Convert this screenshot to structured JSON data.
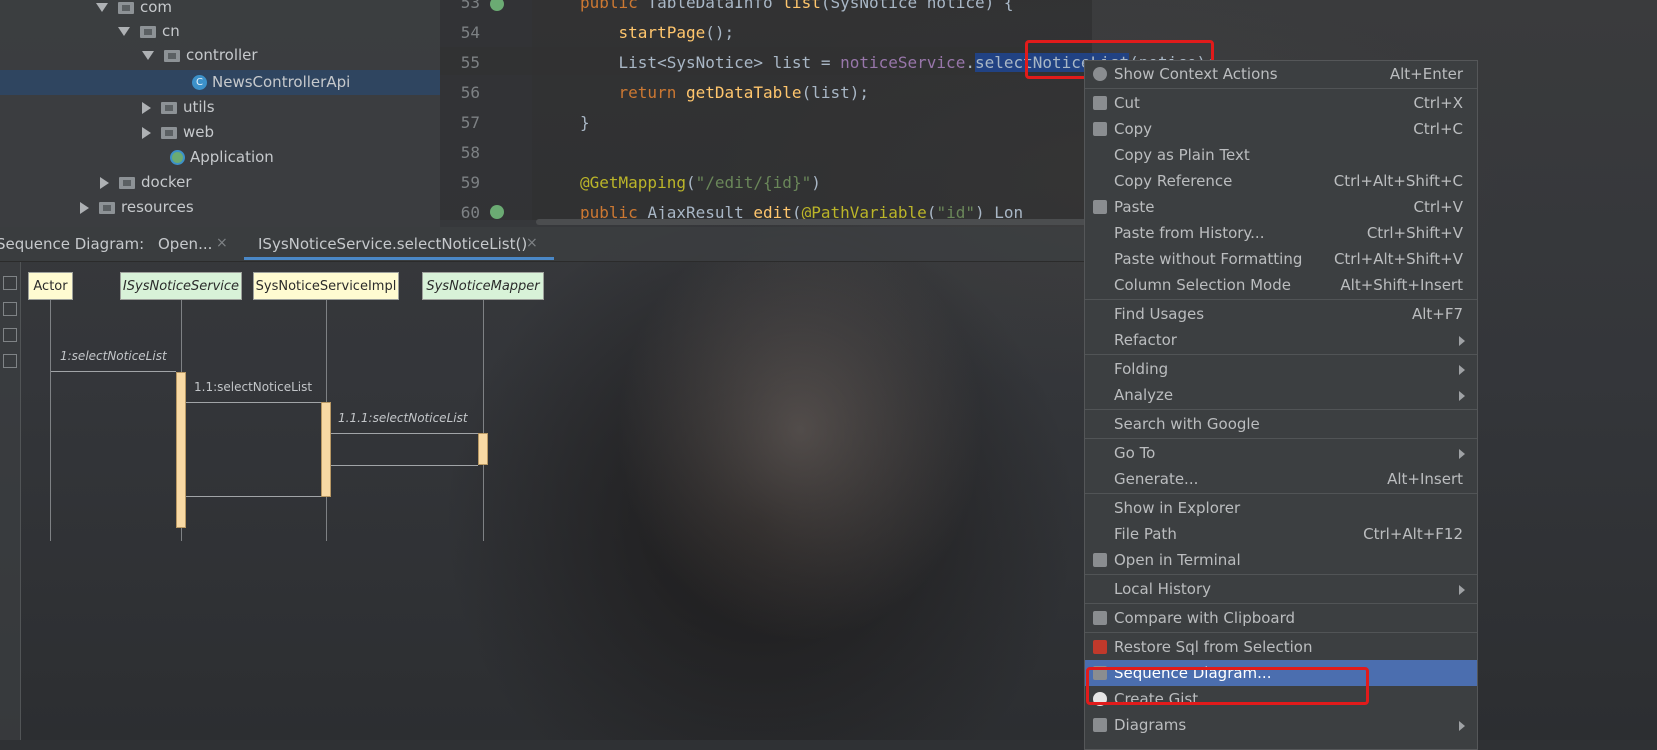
{
  "project_tree": {
    "items": [
      {
        "label": "com",
        "state": "expanded"
      },
      {
        "label": "cn",
        "state": "expanded"
      },
      {
        "label": "controller",
        "state": "expanded"
      },
      {
        "label": "NewsControllerApi",
        "state": "selected",
        "icon": "class-icon"
      },
      {
        "label": "utils",
        "state": "collapsed"
      },
      {
        "label": "web",
        "state": "collapsed"
      },
      {
        "label": "Application",
        "icon": "spring-app-icon"
      },
      {
        "label": "docker",
        "state": "collapsed"
      },
      {
        "label": "resources",
        "state": "collapsed"
      }
    ]
  },
  "editor": {
    "line_numbers": [
      "53",
      "54",
      "55",
      "56",
      "57",
      "58",
      "59",
      "60"
    ],
    "lines": [
      {
        "segments": [
          [
            "kw",
            "public "
          ],
          [
            "ty",
            "TableDataInfo "
          ],
          [
            "fn",
            "list"
          ],
          [
            "ty",
            "("
          ],
          [
            "ty",
            "SysNotice notice) {"
          ]
        ]
      },
      {
        "segments": [
          [
            "fn",
            "    startPage"
          ],
          [
            "ty",
            "();"
          ]
        ]
      },
      {
        "segments": [
          [
            "ty",
            "    "
          ],
          [
            "ty",
            "List"
          ],
          [
            "ty",
            "<SysNotice> list = "
          ],
          [
            "fd",
            "noticeService"
          ],
          [
            "ty",
            "."
          ],
          [
            "hl",
            "selectNoticeList"
          ],
          [
            "ty",
            "(notice);"
          ]
        ]
      },
      {
        "segments": [
          [
            "kw",
            "    return "
          ],
          [
            "fn",
            "getDataTable"
          ],
          [
            "ty",
            "(list);"
          ]
        ]
      },
      {
        "segments": [
          [
            "ty",
            "}"
          ]
        ]
      },
      {
        "segments": [
          [
            "ty",
            ""
          ]
        ]
      },
      {
        "segments": [
          [
            "an",
            "@GetMapping"
          ],
          [
            "ty",
            "("
          ],
          [
            "st",
            "\"/edit/{id}\""
          ],
          [
            "ty",
            ")"
          ]
        ]
      },
      {
        "segments": [
          [
            "kw",
            "public "
          ],
          [
            "ty",
            "AjaxResult "
          ],
          [
            "fn",
            "edit"
          ],
          [
            "ty",
            "("
          ],
          [
            "an",
            "@PathVariable"
          ],
          [
            "ty",
            "("
          ],
          [
            "st",
            "\"id\""
          ],
          [
            "ty",
            ") Lon"
          ]
        ]
      }
    ]
  },
  "tabs": {
    "prefix": "Sequence Diagram:",
    "items": [
      {
        "label": "Open...",
        "close": "×"
      },
      {
        "label": "ISysNoticeService.selectNoticeList()",
        "close": "×",
        "active": true
      }
    ]
  },
  "diagram": {
    "participants": [
      "Actor",
      "ISysNoticeService",
      "SysNoticeServiceImpl",
      "SysNoticeMapper"
    ],
    "messages": [
      "1:selectNoticeList",
      "1.1:selectNoticeList",
      "1.1.1:selectNoticeList"
    ]
  },
  "context_menu": {
    "items": [
      {
        "label": "Show Context Actions",
        "shortcut": "Alt+Enter",
        "icon": "bulb-icon"
      },
      {
        "sep": true
      },
      {
        "label": "Cut",
        "shortcut": "Ctrl+X",
        "icon": "scissors-icon"
      },
      {
        "label": "Copy",
        "shortcut": "Ctrl+C",
        "icon": "copy-icon"
      },
      {
        "label": "Copy as Plain Text",
        "shortcut": ""
      },
      {
        "label": "Copy Reference",
        "shortcut": "Ctrl+Alt+Shift+C"
      },
      {
        "label": "Paste",
        "shortcut": "Ctrl+V",
        "icon": "clipboard-icon"
      },
      {
        "label": "Paste from History...",
        "shortcut": "Ctrl+Shift+V"
      },
      {
        "label": "Paste without Formatting",
        "shortcut": "Ctrl+Alt+Shift+V"
      },
      {
        "label": "Column Selection Mode",
        "shortcut": "Alt+Shift+Insert"
      },
      {
        "sep": true
      },
      {
        "label": "Find Usages",
        "shortcut": "Alt+F7"
      },
      {
        "label": "Refactor",
        "submenu": true
      },
      {
        "sep": true
      },
      {
        "label": "Folding",
        "submenu": true
      },
      {
        "label": "Analyze",
        "submenu": true
      },
      {
        "sep": true
      },
      {
        "label": "Search with Google",
        "shortcut": ""
      },
      {
        "sep": true
      },
      {
        "label": "Go To",
        "submenu": true
      },
      {
        "label": "Generate...",
        "shortcut": "Alt+Insert"
      },
      {
        "sep": true
      },
      {
        "label": "Show in Explorer",
        "shortcut": ""
      },
      {
        "label": "File Path",
        "shortcut": "Ctrl+Alt+F12"
      },
      {
        "label": "Open in Terminal",
        "shortcut": "",
        "icon": "terminal-icon"
      },
      {
        "sep": true
      },
      {
        "label": "Local History",
        "submenu": true
      },
      {
        "sep": true
      },
      {
        "label": "Compare with Clipboard",
        "shortcut": "",
        "icon": "compare-icon"
      },
      {
        "sep": true
      },
      {
        "label": "Restore Sql from Selection",
        "shortcut": "",
        "icon": "bird-icon"
      },
      {
        "label": "Sequence Diagram...",
        "shortcut": "",
        "icon": "sequence-icon",
        "active": true
      },
      {
        "label": "Create Gist...",
        "shortcut": "",
        "icon": "github-icon"
      },
      {
        "label": "Diagrams",
        "submenu": true,
        "icon": "diagram-icon"
      }
    ]
  },
  "colors": {
    "highlight_box": "#e11b1b",
    "menu_active": "#4b6eaf",
    "keyword": "#cc7832",
    "function": "#ffc66d",
    "annotation": "#bbb529",
    "string": "#6a8759"
  }
}
